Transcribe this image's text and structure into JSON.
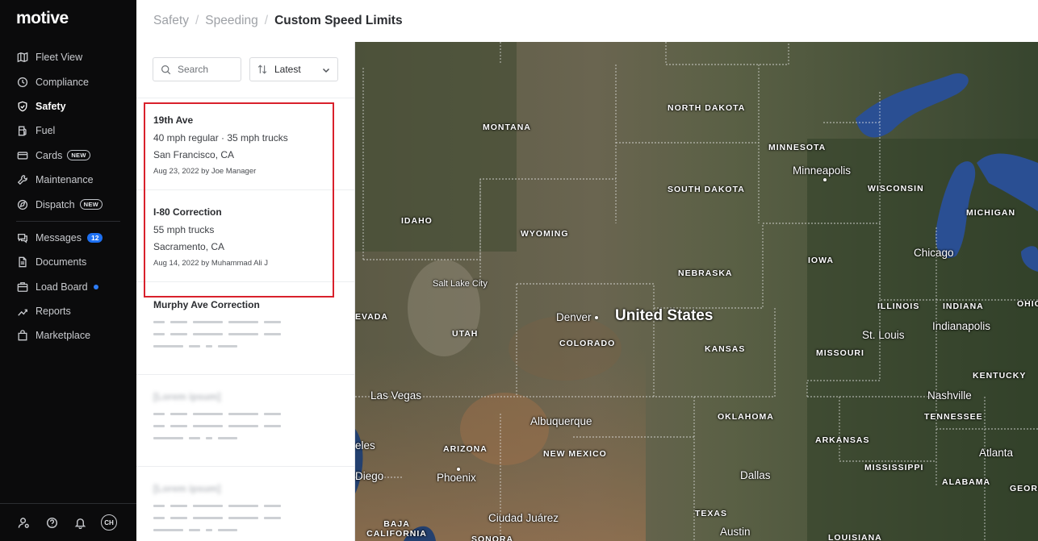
{
  "brand": {
    "logo_text": "motive"
  },
  "sidebar": {
    "items": [
      {
        "label": "Fleet View",
        "icon": "map-icon"
      },
      {
        "label": "Compliance",
        "icon": "clock-icon"
      },
      {
        "label": "Safety",
        "icon": "shield-icon",
        "active": true
      },
      {
        "label": "Fuel",
        "icon": "fuel-icon"
      },
      {
        "label": "Cards",
        "icon": "card-icon",
        "badge": "NEW"
      },
      {
        "label": "Maintenance",
        "icon": "wrench-icon"
      },
      {
        "label": "Dispatch",
        "icon": "dispatch-icon",
        "badge": "NEW"
      },
      {
        "label": "Messages",
        "icon": "messages-icon",
        "count": "12"
      },
      {
        "label": "Documents",
        "icon": "document-icon"
      },
      {
        "label": "Load Board",
        "icon": "load-board-icon",
        "dot": true
      },
      {
        "label": "Reports",
        "icon": "reports-icon"
      },
      {
        "label": "Marketplace",
        "icon": "marketplace-icon"
      }
    ],
    "bottom": {
      "avatar_initials": "CH"
    }
  },
  "header": {
    "breadcrumb": [
      "Safety",
      "Speeding"
    ],
    "current": "Custom Speed Limits"
  },
  "list": {
    "search_placeholder": "Search",
    "sort_label": "Latest",
    "items": [
      {
        "title": "19th Ave",
        "limits": "40 mph regular · 35 mph trucks",
        "location": "San Francisco, CA",
        "meta": "Aug 23, 2022 by Joe Manager"
      },
      {
        "title": "I-80 Correction",
        "limits": "55 mph trucks",
        "location": "Sacramento, CA",
        "meta": "Aug 14, 2022 by Muhammad Ali J"
      },
      {
        "title": "Murphy Ave Correction"
      },
      {
        "title": "[Lorem ipsum]"
      },
      {
        "title": "[Lorem ipsum]"
      }
    ]
  },
  "map": {
    "country": "United States",
    "states": [
      "MONTANA",
      "NORTH DAKOTA",
      "MINNESOTA",
      "WISCONSIN",
      "MICHIGAN",
      "SOUTH DAKOTA",
      "IDAHO",
      "WYOMING",
      "NEBRASKA",
      "IOWA",
      "ILLINOIS",
      "INDIANA",
      "OHIO",
      "EVADA",
      "UTAH",
      "COLORADO",
      "KANSAS",
      "MISSOURI",
      "KENTUCKY",
      "TENNESSEE",
      "OKLAHOMA",
      "ARKANSAS",
      "ARIZONA",
      "NEW MEXICO",
      "MISSISSIPPI",
      "ALABAMA",
      "GEORGIA",
      "TEXAS",
      "LOUISIANA",
      "BAJA CALIFORNIA",
      "SONORA"
    ],
    "cities": [
      "Minneapolis",
      "Chicago",
      "Salt Lake City",
      "Denver",
      "St. Louis",
      "Indianapolis",
      "Las Vegas",
      "Nashville",
      "Albuquerque",
      "Atlanta",
      "Phoenix",
      "Dallas",
      "Diego",
      "eles",
      "Ciudad Juárez",
      "Austin"
    ]
  }
}
